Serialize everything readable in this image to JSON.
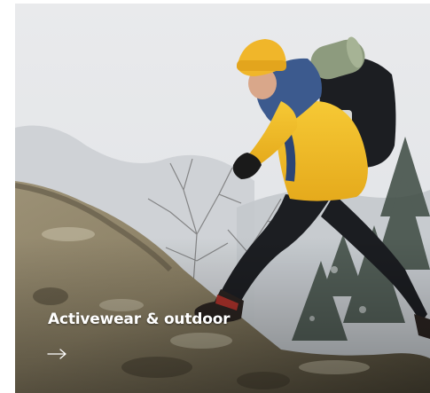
{
  "card": {
    "title": "Activewear & outdoor",
    "arrow_icon": "arrow-right-icon",
    "image_subject": "hiker-photo",
    "colors": {
      "sky": "#e6e8ea",
      "rock": "#8a8068",
      "jacket": "#f2c12e",
      "beanie": "#f0b62a",
      "text": "#ffffff"
    }
  }
}
